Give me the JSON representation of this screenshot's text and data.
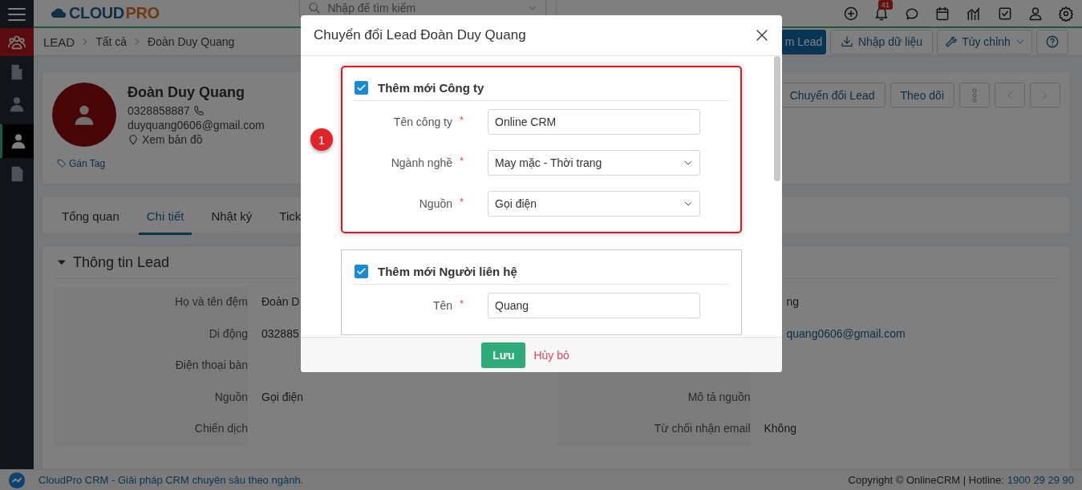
{
  "logo": {
    "text": "CLOUD",
    "accent": "PRO"
  },
  "search": {
    "placeholder": "Nhập để tìm kiếm"
  },
  "notifications": {
    "count": "41"
  },
  "sidebar": {
    "items": [
      {
        "selected": false,
        "active_module": true
      },
      {
        "selected": false,
        "active_module": false
      },
      {
        "selected": false,
        "active_module": false
      },
      {
        "selected": true,
        "active_module": false
      },
      {
        "selected": false,
        "active_module": false
      }
    ]
  },
  "breadcrumb": [
    "LEAD",
    "Tất cả",
    "Đoàn Duy Quang"
  ],
  "toolbar": {
    "primary": "m Lead",
    "import": "Nhập dữ liệu",
    "customize": "Tùy chỉnh"
  },
  "profile": {
    "name": "Đoàn Duy Quang",
    "phone": "0328858887",
    "email": "duyquang0606@gmail.com",
    "map": "Xem bản đồ",
    "tag": "Gán Tag",
    "actions": [
      "Chuyển đổi Lead",
      "Theo dõi"
    ]
  },
  "tabs": [
    {
      "label": "Tổng quan",
      "selected": false
    },
    {
      "label": "Chi tiết",
      "selected": true
    },
    {
      "label": "Nhật ký",
      "selected": false
    },
    {
      "label": "Tick",
      "selected": false
    }
  ],
  "info": {
    "title": "Thông tin Lead",
    "expanded": true,
    "left": [
      {
        "label": "Họ và tên đệm",
        "value": "Đoàn D"
      },
      {
        "label": "Di động",
        "value": "032885"
      },
      {
        "label": "Điện thoại bàn"
      },
      {
        "label": "Nguồn",
        "value": "Gọi điện"
      },
      {
        "label": "Chiến dịch"
      }
    ],
    "right": [
      {
        "value": "ng"
      },
      {
        "value": "quang0606@gmail.com",
        "kind": "link"
      },
      {
        "kind": "covered"
      },
      {
        "label": "Mô tả nguồn"
      },
      {
        "label": "Từ chối nhận email",
        "value": "Không"
      }
    ]
  },
  "footer": {
    "tagline": "CloudPro CRM - Giải pháp CRM chuyên sâu theo ngành.",
    "copyright": "Copyright © OnlineCRM | Hotline:",
    "hotline": "1900 29 29 90"
  },
  "modal": {
    "title": "Chuyển đổi Lead Đoàn Duy Quang",
    "step": "1",
    "sections": [
      {
        "title": "Thêm mới Công ty",
        "checked": true,
        "highlighted": true,
        "fields": [
          {
            "label": "Tên công ty",
            "mark": "*",
            "kind": "text",
            "value": "Online CRM"
          },
          {
            "label": "Ngành nghề",
            "mark": "*",
            "kind": "select",
            "value": "May mặc - Thời trang"
          },
          {
            "label": "Nguồn",
            "mark": "*",
            "kind": "select",
            "value": "Gọi điện"
          }
        ]
      },
      {
        "title": "Thêm mới Người liên hệ",
        "checked": true,
        "highlighted": false,
        "fields": [
          {
            "label": "Tên",
            "mark": "*",
            "kind": "text",
            "value": "Quang"
          }
        ]
      }
    ],
    "save": "Lưu",
    "cancel": "Hủy bỏ"
  }
}
